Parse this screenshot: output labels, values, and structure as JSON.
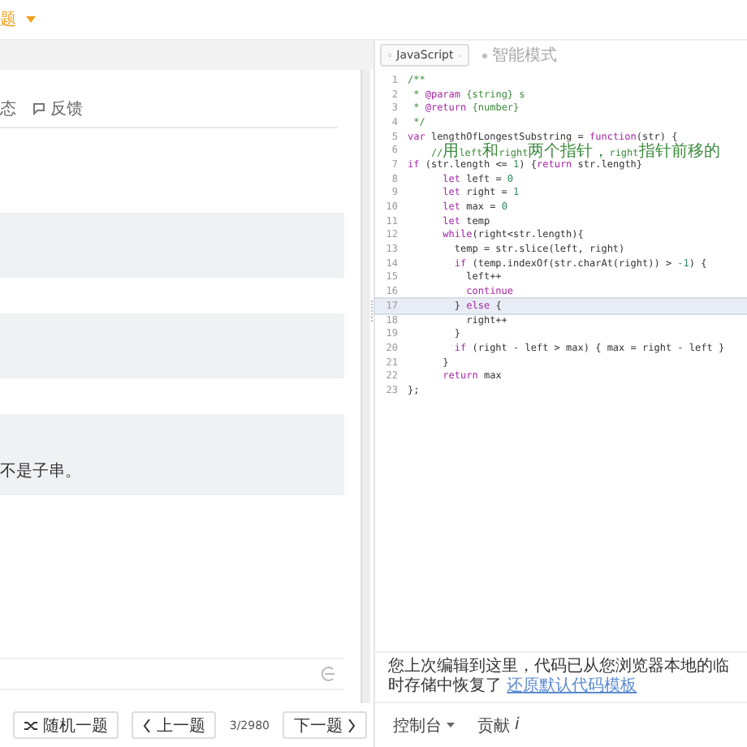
{
  "header": {
    "title_fragment": "题"
  },
  "left_panel": {
    "tabs": [
      {
        "label": "态",
        "selected": false
      },
      {
        "label": "反馈",
        "selected": false
      }
    ],
    "answer_text": "不是子串。",
    "pager": {
      "random": "随机一题",
      "prev": "上一题",
      "count": "3/2980",
      "next": "下一题"
    }
  },
  "editor": {
    "language": "JavaScript",
    "mode": "智能模式",
    "lines": [
      {
        "number": "1",
        "current": false,
        "tokens": [
          {
            "kind": "comment",
            "text": "/**"
          }
        ]
      },
      {
        "number": "2",
        "current": false,
        "tokens": [
          {
            "kind": "comment",
            "text": " * "
          },
          {
            "kind": "keyword",
            "text": "@param"
          },
          {
            "kind": "comment",
            "text": " {string} s"
          }
        ]
      },
      {
        "number": "3",
        "current": false,
        "tokens": [
          {
            "kind": "comment",
            "text": " * "
          },
          {
            "kind": "keyword",
            "text": "@return"
          },
          {
            "kind": "comment",
            "text": " {number}"
          }
        ]
      },
      {
        "number": "4",
        "current": false,
        "tokens": [
          {
            "kind": "comment",
            "text": " */"
          }
        ]
      },
      {
        "number": "5",
        "current": false,
        "tokens": [
          {
            "kind": "keyword",
            "text": "var"
          },
          {
            "kind": "plain",
            "text": " lengthOfLongestSubstring = "
          },
          {
            "kind": "keyword",
            "text": "function"
          },
          {
            "kind": "plain",
            "text": "(str) {"
          }
        ]
      },
      {
        "number": "6",
        "current": false,
        "tokens": [
          {
            "kind": "comment",
            "text": "    //用left和right两个指针，right指针前移的"
          }
        ]
      },
      {
        "number": "7",
        "current": false,
        "tokens": [
          {
            "kind": "keyword",
            "text": "if"
          },
          {
            "kind": "plain",
            "text": " (str.length <= "
          },
          {
            "kind": "number",
            "text": "1"
          },
          {
            "kind": "plain",
            "text": ") {"
          },
          {
            "kind": "keyword",
            "text": "return"
          },
          {
            "kind": "plain",
            "text": " str.length}"
          }
        ]
      },
      {
        "number": "8",
        "current": false,
        "tokens": [
          {
            "kind": "keyword",
            "text": "      let"
          },
          {
            "kind": "plain",
            "text": " left = "
          },
          {
            "kind": "number",
            "text": "0"
          }
        ]
      },
      {
        "number": "9",
        "current": false,
        "tokens": [
          {
            "kind": "keyword",
            "text": "      let"
          },
          {
            "kind": "plain",
            "text": " right = "
          },
          {
            "kind": "number",
            "text": "1"
          }
        ]
      },
      {
        "number": "10",
        "current": false,
        "tokens": [
          {
            "kind": "keyword",
            "text": "      let"
          },
          {
            "kind": "plain",
            "text": " max = "
          },
          {
            "kind": "number",
            "text": "0"
          }
        ]
      },
      {
        "number": "11",
        "current": false,
        "tokens": [
          {
            "kind": "keyword",
            "text": "      let"
          },
          {
            "kind": "plain",
            "text": " temp"
          }
        ]
      },
      {
        "number": "12",
        "current": false,
        "tokens": [
          {
            "kind": "keyword",
            "text": "      while"
          },
          {
            "kind": "plain",
            "text": "(right<str.length){"
          }
        ]
      },
      {
        "number": "13",
        "current": false,
        "tokens": [
          {
            "kind": "plain",
            "text": "        temp = str.slice(left, right)"
          }
        ]
      },
      {
        "number": "14",
        "current": false,
        "tokens": [
          {
            "kind": "keyword",
            "text": "        if"
          },
          {
            "kind": "plain",
            "text": " (temp.indexOf(str.charAt(right)) > "
          },
          {
            "kind": "number",
            "text": "-1"
          },
          {
            "kind": "plain",
            "text": ") {"
          }
        ]
      },
      {
        "number": "15",
        "current": false,
        "tokens": [
          {
            "kind": "plain",
            "text": "          left++"
          }
        ]
      },
      {
        "number": "16",
        "current": false,
        "tokens": [
          {
            "kind": "keyword",
            "text": "          continue"
          }
        ]
      },
      {
        "number": "17",
        "current": true,
        "tokens": [
          {
            "kind": "plain",
            "text": "        } "
          },
          {
            "kind": "keyword",
            "text": "else"
          },
          {
            "kind": "plain",
            "text": " {"
          }
        ]
      },
      {
        "number": "18",
        "current": false,
        "tokens": [
          {
            "kind": "plain",
            "text": "          right++"
          }
        ]
      },
      {
        "number": "19",
        "current": false,
        "tokens": [
          {
            "kind": "plain",
            "text": "        }"
          }
        ]
      },
      {
        "number": "20",
        "current": false,
        "tokens": [
          {
            "kind": "keyword",
            "text": "        if"
          },
          {
            "kind": "plain",
            "text": " (right - left > max) { max = right - left }"
          }
        ]
      },
      {
        "number": "21",
        "current": false,
        "tokens": [
          {
            "kind": "plain",
            "text": "      }"
          }
        ]
      },
      {
        "number": "22",
        "current": false,
        "tokens": [
          {
            "kind": "keyword",
            "text": "      return"
          },
          {
            "kind": "plain",
            "text": " max"
          }
        ]
      },
      {
        "number": "23",
        "current": false,
        "tokens": [
          {
            "kind": "plain",
            "text": "};"
          }
        ]
      }
    ],
    "notice": {
      "text": "您上次编辑到这里，代码已从您浏览器本地的临时存储中恢复了",
      "link": "还原默认代码模板"
    },
    "footer": {
      "console": "控制台",
      "contribute": "贡献",
      "info": "i"
    }
  }
}
